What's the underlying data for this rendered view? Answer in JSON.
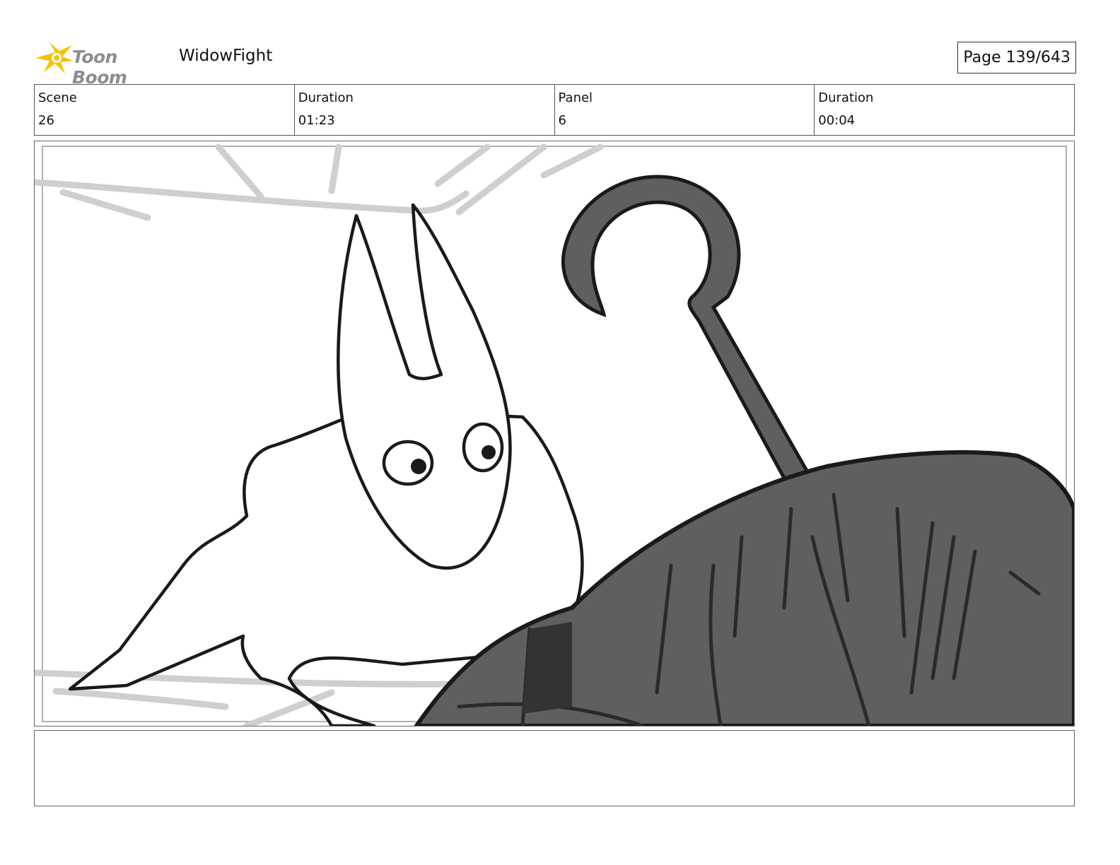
{
  "header": {
    "logo_text": "Toon Boom",
    "project_title": "WidowFight",
    "page_label": "Page 139/643"
  },
  "info": {
    "scene_label": "Scene",
    "scene_value": "26",
    "scene_duration_label": "Duration",
    "scene_duration_value": "01:23",
    "panel_label": "Panel",
    "panel_value": "6",
    "panel_duration_label": "Duration",
    "panel_duration_value": "00:04"
  },
  "notes": {
    "text": ""
  },
  "colors": {
    "logo_star": "#f5c400",
    "logo_text": "#8e8e8e",
    "ink": "#1a1a1a",
    "dark_fill": "#5f5f5f",
    "web_gray": "#cccccc"
  }
}
